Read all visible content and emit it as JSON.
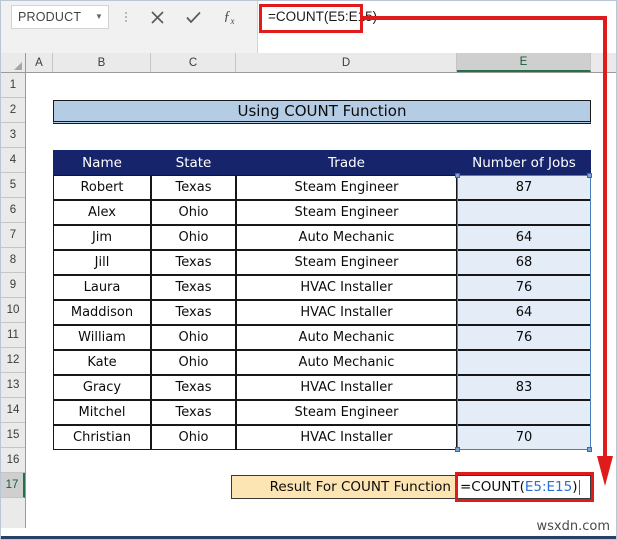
{
  "formula_bar": {
    "name_box_value": "PRODUCT",
    "name_box_caret": "▼",
    "cancel_label": "✕",
    "enter_label": "✓",
    "fx_label": "fx",
    "formula_text": "=COUNT(E5:E15)"
  },
  "grid": {
    "column_headers": [
      "A",
      "B",
      "C",
      "D",
      "E"
    ],
    "active_column": "E",
    "row_headers": [
      "1",
      "2",
      "3",
      "4",
      "5",
      "6",
      "7",
      "8",
      "9",
      "10",
      "11",
      "12",
      "13",
      "14",
      "15",
      "16",
      "17"
    ],
    "active_row": "17"
  },
  "title": {
    "text": "Using COUNT Function"
  },
  "table": {
    "headers": [
      "Name",
      "State",
      "Trade",
      "Number of Jobs"
    ],
    "rows": [
      {
        "name": "Robert",
        "state": "Texas",
        "trade": "Steam Engineer",
        "jobs": "87"
      },
      {
        "name": "Alex",
        "state": "Ohio",
        "trade": "Steam Engineer",
        "jobs": ""
      },
      {
        "name": "Jim",
        "state": "Ohio",
        "trade": "Auto Mechanic",
        "jobs": "64"
      },
      {
        "name": "Jill",
        "state": "Texas",
        "trade": "Steam Engineer",
        "jobs": "68"
      },
      {
        "name": "Laura",
        "state": "Texas",
        "trade": "HVAC Installer",
        "jobs": "76"
      },
      {
        "name": "Maddison",
        "state": "Texas",
        "trade": "HVAC Installer",
        "jobs": "64"
      },
      {
        "name": "William",
        "state": "Ohio",
        "trade": "Auto Mechanic",
        "jobs": "76"
      },
      {
        "name": "Kate",
        "state": "Ohio",
        "trade": "Auto Mechanic",
        "jobs": ""
      },
      {
        "name": "Gracy",
        "state": "Texas",
        "trade": "HVAC Installer",
        "jobs": "83"
      },
      {
        "name": "Mitchel",
        "state": "Texas",
        "trade": "Steam Engineer",
        "jobs": ""
      },
      {
        "name": "Christian",
        "state": "Ohio",
        "trade": "HVAC Installer",
        "jobs": "70"
      }
    ]
  },
  "result": {
    "label": "Result For COUNT Function",
    "formula_prefix": "=COUNT(",
    "formula_ref": "E5:E15",
    "formula_suffix": ")"
  },
  "watermark": {
    "text": "wsxdn.com"
  },
  "colors": {
    "header_navy": "#16256b",
    "title_blue": "#b4cde4",
    "result_tan": "#fce4b3",
    "selection_fill": "#e4ecf7",
    "selection_border": "#4a7ebb",
    "annotation_red": "#e01b1b",
    "excel_green": "#217346"
  }
}
